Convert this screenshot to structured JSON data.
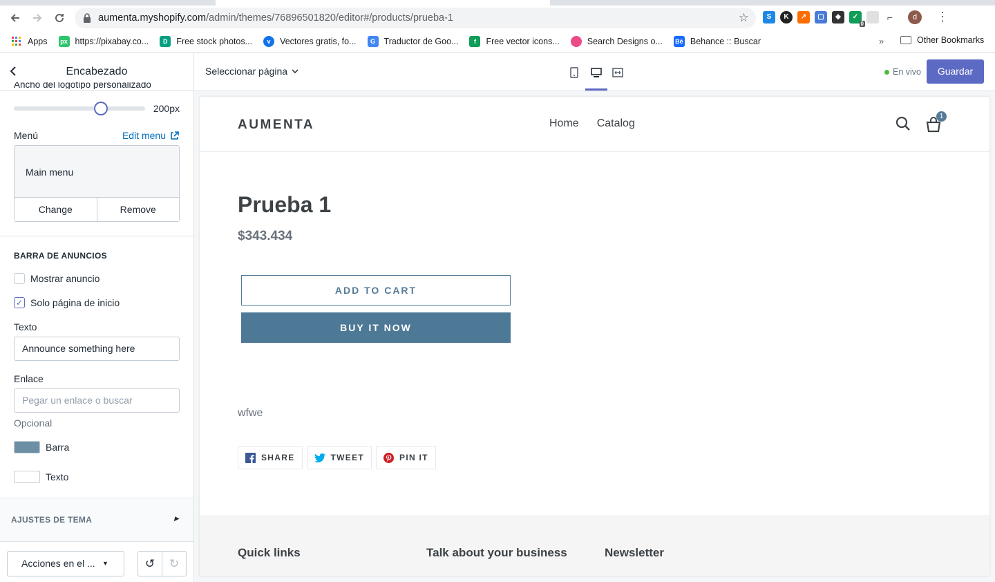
{
  "browser": {
    "url_host": "aumenta.myshopify.com",
    "url_path": "/admin/themes/76896501820/editor#/products/prueba-1",
    "profile_initial": "d",
    "bookmarks": [
      {
        "label": "Apps",
        "color": "#e8453c",
        "icon": "apps-grid-icon"
      },
      {
        "label": "https://pixabay.co...",
        "color": "#2ec66d",
        "icon": "px"
      },
      {
        "label": "Free stock photos...",
        "color": "#05a081",
        "icon": "D"
      },
      {
        "label": "Vectores gratis, fo...",
        "color": "#1273eb",
        "icon": "v"
      },
      {
        "label": "Traductor de Goo...",
        "color": "#4285f4",
        "icon": "G"
      },
      {
        "label": "Free vector icons...",
        "color": "#0f9d58",
        "icon": "f"
      },
      {
        "label": "Search Designs o...",
        "color": "#ea4c89",
        "icon": "d"
      },
      {
        "label": "Behance :: Buscar",
        "color": "#1769ff",
        "icon": "Bē"
      }
    ],
    "more": "»",
    "other_bookmarks": "Other Bookmarks",
    "extension_badge": "0"
  },
  "sidebar": {
    "title": "Encabezado",
    "cut_label": "Ancho del logotipo personalizado",
    "slider_value": "200px",
    "slider_fraction": 0.68,
    "menu_label": "Menú",
    "edit_menu": "Edit menu",
    "menu_name": "Main menu",
    "change": "Change",
    "remove": "Remove",
    "announce_section": "BARRA DE ANUNCIOS",
    "show_announce": "Mostrar anuncio",
    "home_only": "Solo página de inicio",
    "text_label": "Texto",
    "text_value": "Announce something here",
    "link_label": "Enlace",
    "link_placeholder": "Pegar un enlace o buscar",
    "optional": "Opcional",
    "bar_color_label": "Barra",
    "bar_color": "#6c8fa6",
    "text_color_label": "Texto",
    "text_color": "#ffffff",
    "theme_settings": "AJUSTES DE TEMA",
    "actions": "Acciones en el ..."
  },
  "editor": {
    "page_select": "Seleccionar página",
    "live": "En vivo",
    "save": "Guardar"
  },
  "store": {
    "logo": "AUMENTA",
    "nav": [
      "Home",
      "Catalog"
    ],
    "cart_count": "1",
    "product_title": "Prueba 1",
    "price": "$343.434",
    "add_to_cart": "ADD TO CART",
    "buy_now": "BUY IT NOW",
    "description": "wfwe",
    "share": "SHARE",
    "tweet": "TWEET",
    "pin": "PIN IT",
    "footer": [
      "Quick links",
      "Talk about your business",
      "Newsletter"
    ]
  }
}
